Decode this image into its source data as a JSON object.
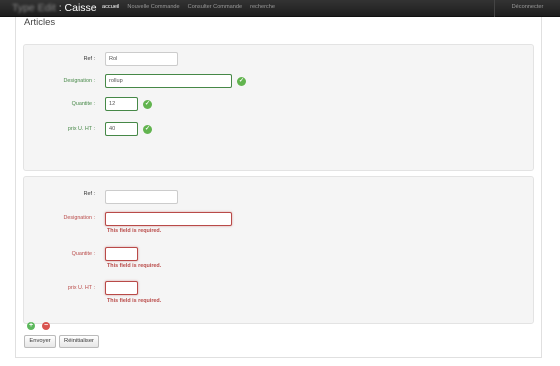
{
  "app": {
    "brand_blurred": "Type Edit",
    "brand_sep": " : ",
    "brand_name": "Caisse"
  },
  "nav": [
    {
      "label": "accueil",
      "active": true
    },
    {
      "label": "Nouvelle Commande",
      "active": false
    },
    {
      "label": "Consulter Commande",
      "active": false
    },
    {
      "label": "recherche",
      "active": false
    }
  ],
  "logout_label": "Déconnecter",
  "page_title": "Articles",
  "article1": {
    "ref_label": "Ref :",
    "ref_value": "Rol",
    "designation_label": "Designation :",
    "designation_value": "rollup",
    "quantite_label": "Quantite :",
    "quantite_value": "12",
    "prix_label": "prix U. HT :",
    "prix_value": "40"
  },
  "article2": {
    "ref_label": "Ref :",
    "ref_value": "",
    "designation_label": "Designation :",
    "designation_value": "",
    "quantite_label": "Quantite :",
    "quantite_value": "",
    "prix_label": "prix U. HT :",
    "prix_value": "",
    "error_message": "This field is required."
  },
  "icons": {
    "check": "check-circle-icon",
    "add": "plus-circle-icon",
    "remove": "minus-circle-icon"
  },
  "colors": {
    "navbar": "#222222",
    "success": "#468847",
    "error": "#b94a48"
  },
  "buttons": {
    "submit_label": "Envoyer",
    "reset_label": "Réinitialiser"
  }
}
